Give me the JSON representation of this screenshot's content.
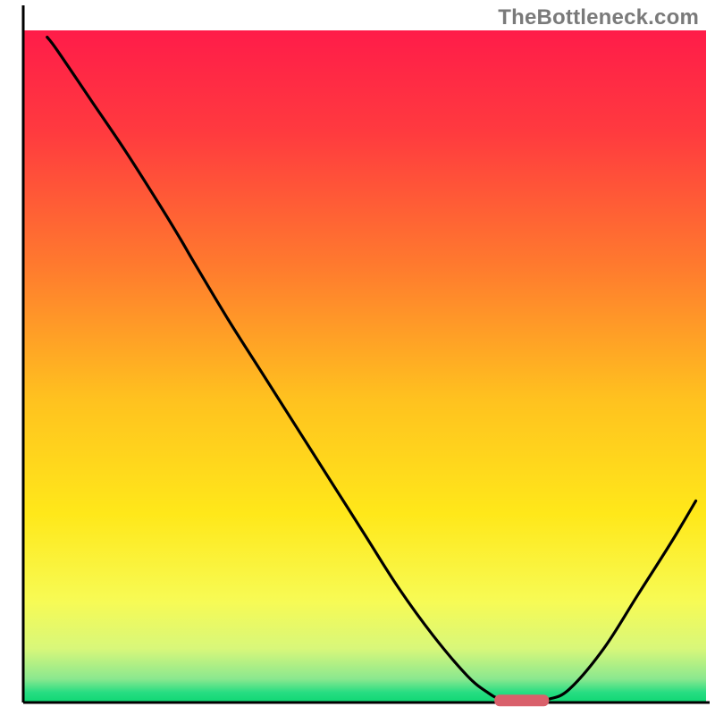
{
  "watermark": "TheBottleneck.com",
  "chart_data": {
    "type": "line",
    "title": "",
    "xlabel": "",
    "ylabel": "",
    "xlim": [
      0,
      100
    ],
    "ylim": [
      0,
      100
    ],
    "series": [
      {
        "name": "bottleneck-curve",
        "x": [
          3.5,
          5,
          10,
          15,
          20,
          23,
          25,
          30,
          35,
          40,
          45,
          50,
          55,
          60,
          65,
          68,
          70,
          73,
          75,
          77,
          80,
          85,
          90,
          95,
          98.5
        ],
        "values": [
          99,
          97,
          89.5,
          82,
          74,
          69,
          65.5,
          57,
          49,
          41,
          33,
          25,
          17,
          10,
          4,
          1.5,
          0.5,
          0.3,
          0.3,
          0.5,
          2,
          8,
          16,
          24,
          30
        ]
      }
    ],
    "marker": {
      "name": "optimal-range",
      "x_start": 69,
      "x_end": 77,
      "y": 0.3,
      "color": "#d9606b"
    },
    "gradient_stops": [
      {
        "offset": 0.0,
        "color": "#ff1c49"
      },
      {
        "offset": 0.15,
        "color": "#ff3a3f"
      },
      {
        "offset": 0.35,
        "color": "#ff7a2e"
      },
      {
        "offset": 0.55,
        "color": "#ffc21f"
      },
      {
        "offset": 0.72,
        "color": "#ffe81a"
      },
      {
        "offset": 0.85,
        "color": "#f7fb55"
      },
      {
        "offset": 0.92,
        "color": "#d8f77a"
      },
      {
        "offset": 0.965,
        "color": "#8ae88f"
      },
      {
        "offset": 0.985,
        "color": "#27dd82"
      },
      {
        "offset": 1.0,
        "color": "#0fd773"
      }
    ],
    "axis": {
      "color": "#000000",
      "width": 3
    }
  }
}
